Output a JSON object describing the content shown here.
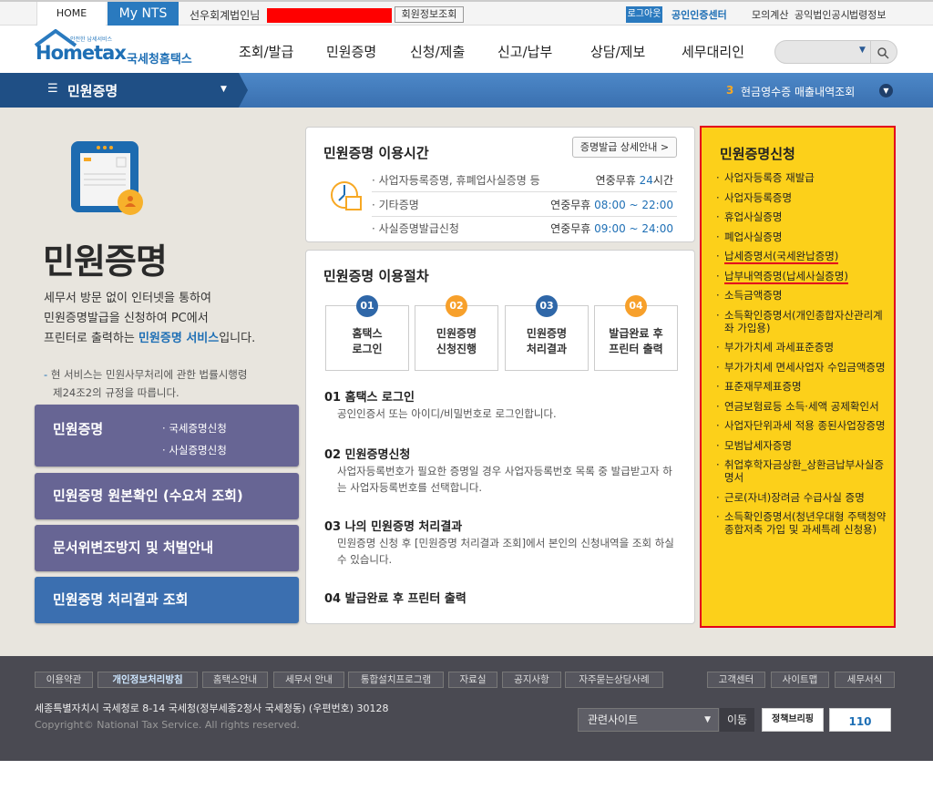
{
  "topbar": {
    "home": "HOME",
    "mynts": "My NTS",
    "user": "선우회계법인님",
    "member_info": "회원정보조회",
    "logout": "로그아웃",
    "cert_center": "공인인증센터",
    "links": [
      "모의계산",
      "공익법인공시",
      "법령정보"
    ]
  },
  "header": {
    "logo_small": "안전한 납세서비스",
    "logo_main": "Hometax",
    "logo_kr": "국세청홈택스",
    "nav": [
      "조회/발급",
      "민원증명",
      "신청/제출",
      "신고/납부",
      "상담/제보",
      "세무대리인"
    ]
  },
  "bluebar": {
    "menu": "민원증명",
    "rank": "3",
    "popular": "현금영수증 매출내역조회"
  },
  "intro": {
    "title": "민원증명",
    "desc1": "세무서 방문 없이 인터넷을 통하여",
    "desc2": "민원증명발급을 신청하여 PC에서",
    "desc3_pre": "프린터로 출력하는 ",
    "desc3_hl": "민원증명 서비스",
    "desc3_post": "입니다.",
    "note1": "현 서비스는 민원사무처리에 관한 법률시행령",
    "note2": "제24조2의 규정을 따릅니다."
  },
  "menus": {
    "m1": "민원증명",
    "m1_sub": [
      "국세증명신청",
      "사실증명신청"
    ],
    "m2": "민원증명 원본확인 (수요처 조회)",
    "m3": "문서위변조방지 및 처벌안내",
    "m4": "민원증명 처리결과 조회"
  },
  "hours": {
    "title": "민원증명 이용시간",
    "detail_btn": "증명발급 상세안내 >",
    "rows": [
      {
        "label": "사업자등록증명, 휴폐업사실증명 등",
        "pre": "연중무휴 ",
        "time": "24",
        "post": "시간"
      },
      {
        "label": "기타증명",
        "pre": "연중무휴 ",
        "time": "08:00 ~ 22:00",
        "post": ""
      },
      {
        "label": "사실증명발급신청",
        "pre": "연중무휴 ",
        "time": "09:00 ~ 24:00",
        "post": ""
      }
    ]
  },
  "procedure": {
    "title": "민원증명 이용절차",
    "steps": [
      {
        "n": "01",
        "l1": "홈택스",
        "l2": "로그인"
      },
      {
        "n": "02",
        "l1": "민원증명",
        "l2": "신청진행"
      },
      {
        "n": "03",
        "l1": "민원증명",
        "l2": "처리결과"
      },
      {
        "n": "04",
        "l1": "발급완료 후",
        "l2": "프린터 출력"
      }
    ],
    "details": [
      {
        "h": "01 홈택스 로그인",
        "d": "공인인증서 또는 아이디/비밀번호로 로그인합니다."
      },
      {
        "h": "02 민원증명신청",
        "d": "사업자등록번호가 필요한 증명일 경우 사업자등록번호 목록 중 발급받고자 하는 사업자등록번호를 선택합니다."
      },
      {
        "h": "03 나의 민원증명 처리결과",
        "d": "민원증명 신청 후 [민원증명 처리결과 조회]에서 본인의 신청내역을 조회 하실 수 있습니다."
      },
      {
        "h": "04 발급완료 후 프린터 출력",
        "d": ""
      }
    ]
  },
  "apply": {
    "title": "민원증명신청",
    "items": [
      "사업자등록증 재발급",
      "사업자등록증명",
      "휴업사실증명",
      "폐업사실증명",
      "납세증명서(국세완납증명)",
      "납부내역증명(납세사실증명)",
      "소득금액증명",
      "소득확인증명서(개인종합자산관리계좌 가입용)",
      "부가가치세 과세표준증명",
      "부가가치세 면세사업자 수입금액증명",
      "표준재무제표증명",
      "연금보험료등 소득·세액 공제확인서",
      "사업자단위과세 적용 종된사업장증명",
      "모범납세자증명",
      "취업후학자금상환_상환금납부사실증명서",
      "근로(자녀)장려금 수급사실 증명",
      "소득확인증명서(청년우대형 주택청약종합저축 가입 및 과세특례 신청용)"
    ]
  },
  "footer": {
    "links": [
      "이용약관",
      "개인정보처리방침",
      "홈택스안내",
      "세무서 안내",
      "통합설치프로그램",
      "자료실",
      "공지사항",
      "자주묻는상담사례"
    ],
    "right_links": [
      "고객센터",
      "사이트맵",
      "세무서식"
    ],
    "address": "세종특별자치시 국세청로 8-14 국세청(정부세종2청사 국세청동) (우편번호) 30128",
    "copyright": "Copyright© National Tax Service. All rights reserved.",
    "related": "관련사이트",
    "go": "이동",
    "banner1": "정책브리핑",
    "banner2": "110"
  },
  "colors": {
    "accent": "#2a7abf",
    "menu": "#676594",
    "highlight": "#fcd01a"
  }
}
